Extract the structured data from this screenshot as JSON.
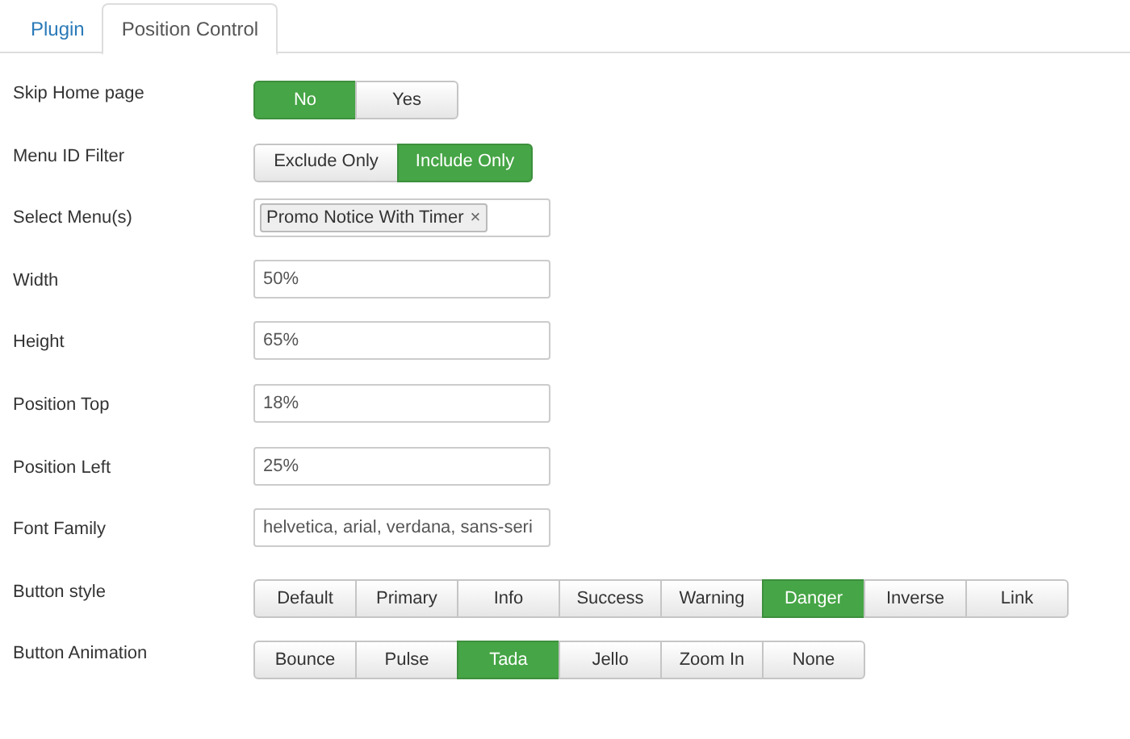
{
  "tabs": [
    {
      "label": "Plugin",
      "selected": false
    },
    {
      "label": "Position Control",
      "selected": true
    }
  ],
  "fields": [
    {
      "kind": "toggle",
      "label": "Skip Home page",
      "options": [
        {
          "label": "No",
          "selected": true
        },
        {
          "label": "Yes",
          "selected": false
        }
      ]
    },
    {
      "kind": "toggle",
      "label": "Menu ID Filter",
      "options": [
        {
          "label": "Exclude Only",
          "selected": false
        },
        {
          "label": "Include Only",
          "selected": true
        }
      ]
    },
    {
      "kind": "tags",
      "label": "Select Menu(s)",
      "tags": [
        {
          "label": "Promo Notice With Timer",
          "remove": "×"
        }
      ]
    },
    {
      "kind": "text",
      "label": "Width",
      "value": "50%"
    },
    {
      "kind": "text",
      "label": "Height",
      "value": "65%"
    },
    {
      "kind": "text",
      "label": "Position Top",
      "value": "18%"
    },
    {
      "kind": "text",
      "label": "Position Left",
      "value": "25%"
    },
    {
      "kind": "text",
      "label": "Font Family",
      "value": "helvetica, arial, verdana, sans-seri"
    },
    {
      "kind": "toggle",
      "label": "Button style",
      "options": [
        {
          "label": "Default",
          "selected": false
        },
        {
          "label": "Primary",
          "selected": false
        },
        {
          "label": "Info",
          "selected": false
        },
        {
          "label": "Success",
          "selected": false
        },
        {
          "label": "Warning",
          "selected": false
        },
        {
          "label": "Danger",
          "selected": true
        },
        {
          "label": "Inverse",
          "selected": false
        },
        {
          "label": "Link",
          "selected": false
        }
      ]
    },
    {
      "kind": "toggle",
      "label": "Button Animation",
      "options": [
        {
          "label": "Bounce",
          "selected": false
        },
        {
          "label": "Pulse",
          "selected": false
        },
        {
          "label": "Tada",
          "selected": true
        },
        {
          "label": "Jello",
          "selected": false
        },
        {
          "label": "Zoom In",
          "selected": false
        },
        {
          "label": "None",
          "selected": false
        }
      ]
    }
  ]
}
